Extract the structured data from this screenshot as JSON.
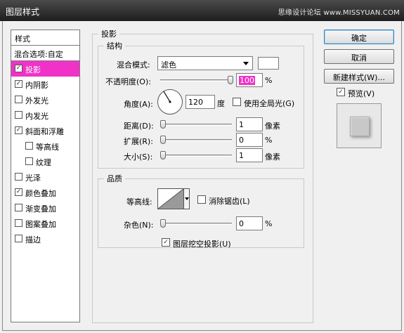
{
  "window": {
    "title": "图层样式",
    "watermark": "思缘设计论坛 www.MISSYUAN.COM"
  },
  "style_list": {
    "header": "样式",
    "blend_options": "混合选项:自定",
    "items": [
      {
        "label": "投影",
        "checked": true,
        "active": true
      },
      {
        "label": "内阴影",
        "checked": true
      },
      {
        "label": "外发光",
        "checked": false
      },
      {
        "label": "内发光",
        "checked": false
      },
      {
        "label": "斜面和浮雕",
        "checked": true
      },
      {
        "label": "等高线",
        "checked": false,
        "sub": true
      },
      {
        "label": "纹理",
        "checked": false,
        "sub": true
      },
      {
        "label": "光泽",
        "checked": false
      },
      {
        "label": "颜色叠加",
        "checked": true
      },
      {
        "label": "渐变叠加",
        "checked": false
      },
      {
        "label": "图案叠加",
        "checked": false
      },
      {
        "label": "描边",
        "checked": false
      }
    ]
  },
  "drop_shadow": {
    "section_title": "投影",
    "structure": {
      "title": "结构",
      "blend_mode_label": "混合模式:",
      "blend_mode_value": "滤色",
      "shadow_color": "#ffffff",
      "opacity_label": "不透明度(O):",
      "opacity_value": "100",
      "opacity_unit": "%",
      "opacity_level": 100,
      "angle_label": "角度(A):",
      "angle_value": "120",
      "angle_unit": "度",
      "global_light_label": "使用全局光(G)",
      "global_light_checked": false,
      "distance_label": "距离(D):",
      "distance_value": "1",
      "distance_unit": "像素",
      "distance_level": 0.4,
      "spread_label": "扩展(R):",
      "spread_value": "0",
      "spread_unit": "%",
      "spread_level": 0,
      "size_label": "大小(S):",
      "size_value": "1",
      "size_unit": "像素",
      "size_level": 0.4
    },
    "quality": {
      "title": "品质",
      "contour_label": "等高线:",
      "antialias_label": "消除锯齿(L)",
      "antialias_checked": false,
      "noise_label": "杂色(N):",
      "noise_value": "0",
      "noise_unit": "%",
      "noise_level": 0
    },
    "knockout_label": "图层挖空投影(U)",
    "knockout_checked": true
  },
  "buttons": {
    "ok": "确定",
    "cancel": "取消",
    "new_style": "新建样式(W)...",
    "preview_label": "预览(V)",
    "preview_checked": true
  },
  "colors": {
    "accent": "#f032c8"
  }
}
